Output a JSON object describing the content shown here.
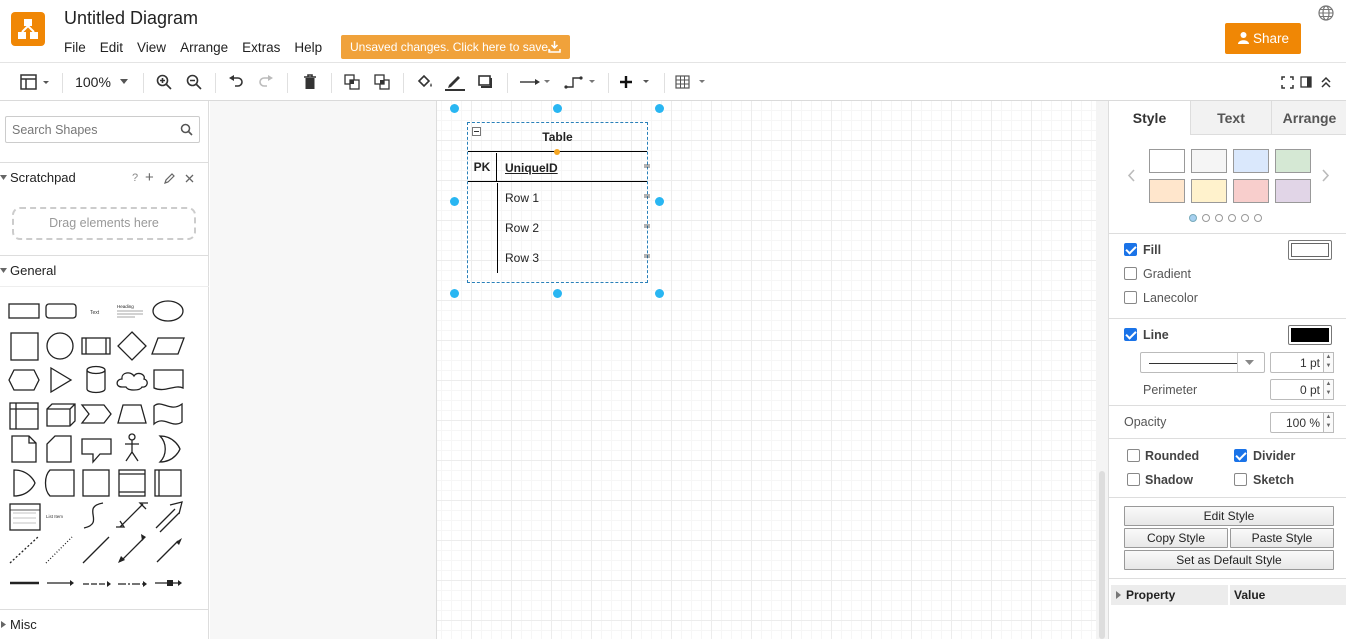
{
  "app": {
    "title": "Untitled Diagram",
    "menu": [
      "File",
      "Edit",
      "View",
      "Arrange",
      "Extras",
      "Help"
    ],
    "unsaved_label": "Unsaved changes. Click here to save.",
    "share_label": "Share",
    "accent": "#f08705"
  },
  "toolbar": {
    "zoom": "100%"
  },
  "left": {
    "search_placeholder": "Search Shapes",
    "scratchpad_title": "Scratchpad",
    "scratchpad_help": "?",
    "dropzone_label": "Drag elements here",
    "general_title": "General",
    "misc_title": "Misc"
  },
  "diagram": {
    "table_title": "Table",
    "pk_label": "PK",
    "pk_field": "UniqueID",
    "rows": [
      "Row 1",
      "Row 2",
      "Row 3"
    ]
  },
  "right": {
    "tabs": [
      "Style",
      "Text",
      "Arrange"
    ],
    "swatches": [
      "#ffffff",
      "#f5f5f5",
      "#dae8fc",
      "#d5e8d4",
      "#ffe6cc",
      "#fff2cc",
      "#f8cecc",
      "#e1d5e7"
    ],
    "fill_label": "Fill",
    "gradient_label": "Gradient",
    "lanecolor_label": "Lanecolor",
    "line_label": "Line",
    "line_width": "1 pt",
    "perimeter_label": "Perimeter",
    "perimeter_value": "0 pt",
    "opacity_label": "Opacity",
    "opacity_value": "100 %",
    "rounded_label": "Rounded",
    "divider_label": "Divider",
    "shadow_label": "Shadow",
    "sketch_label": "Sketch",
    "edit_style": "Edit Style",
    "copy_style": "Copy Style",
    "paste_style": "Paste Style",
    "set_default_style": "Set as Default Style",
    "property_header": "Property",
    "value_header": "Value"
  }
}
